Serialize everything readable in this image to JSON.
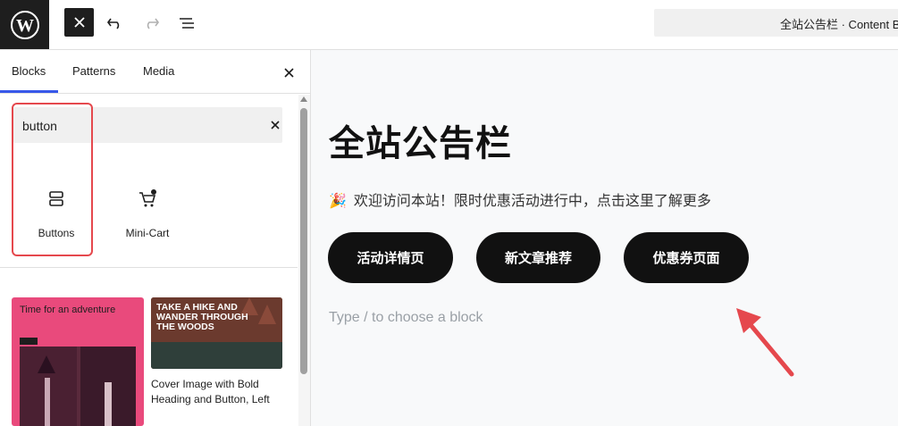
{
  "topbar": {
    "logo_icon": "wordpress-logo-icon",
    "close_icon": "close-icon",
    "undo_icon": "undo-icon",
    "redo_icon": "redo-icon",
    "list_view_icon": "list-view-icon",
    "document_title": "全站公告栏 · Content B"
  },
  "inserter": {
    "tabs": [
      "Blocks",
      "Patterns",
      "Media"
    ],
    "active_tab": "Blocks",
    "search_value": "button",
    "blocks": [
      {
        "label": "Buttons",
        "icon": "buttons-block-icon"
      },
      {
        "label": "Mini-Cart",
        "icon": "mini-cart-icon"
      }
    ],
    "patterns": [
      {
        "preview_text": "Time for an adventure"
      },
      {
        "preview_text": "TAKE A HIKE AND WANDER THROUGH THE WOODS",
        "caption": "Cover Image with Bold Heading and Button, Left"
      }
    ]
  },
  "canvas": {
    "heading": "全站公告栏",
    "notice_emoji": "🎉",
    "notice_text": "欢迎访问本站！限时优惠活动进行中，点击这里了解更多",
    "buttons": [
      "活动详情页",
      "新文章推荐",
      "优惠券页面"
    ],
    "placeholder": "Type / to choose a block"
  },
  "colors": {
    "accent": "#3858e9",
    "highlight": "#e5484d",
    "button_bg": "#111111",
    "pattern_pink": "#e94a7c"
  }
}
